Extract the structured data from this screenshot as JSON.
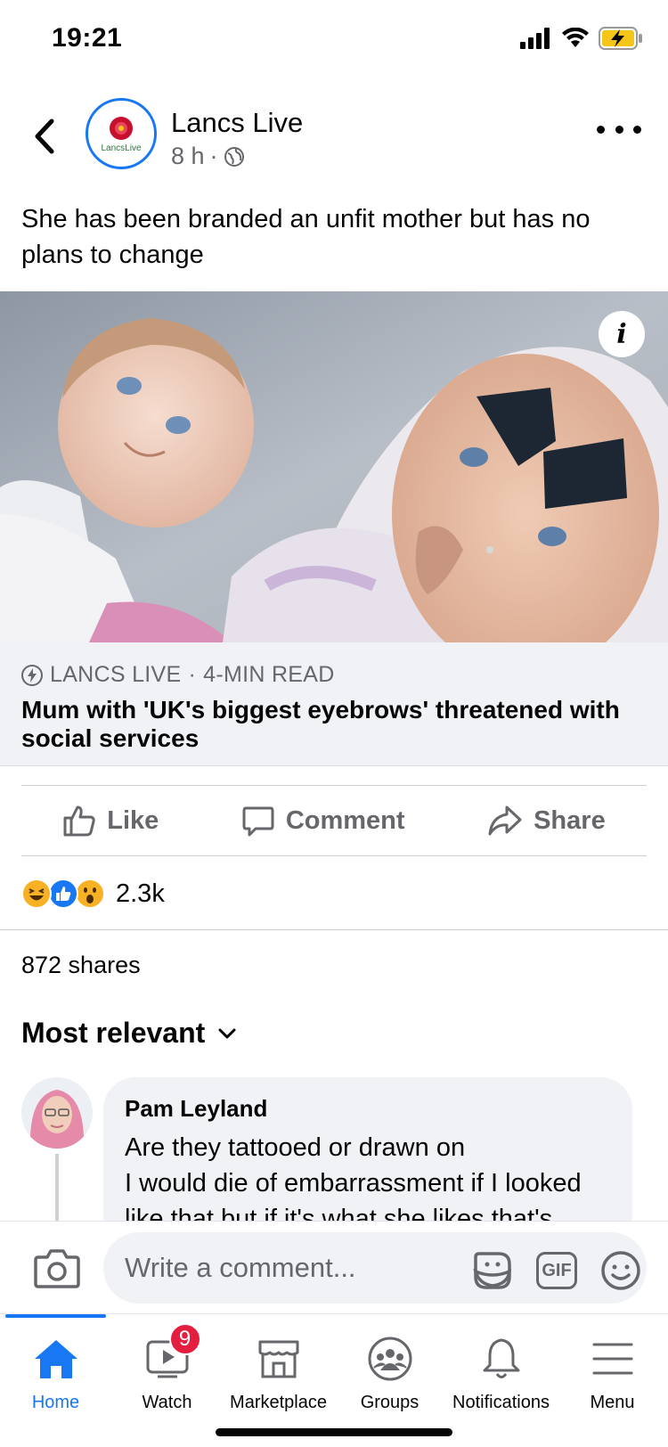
{
  "status_bar": {
    "time": "19:21"
  },
  "post": {
    "page_name": "Lancs Live",
    "avatar_text": "LancsLive",
    "time": "8 h",
    "separator": "·",
    "text": "She has been branded an unfit mother but has no plans to change",
    "link": {
      "source": "LANCS LIVE",
      "read_time": "4-MIN READ",
      "source_separator": "·",
      "title": "Mum with 'UK's biggest eyebrows' threatened with social services"
    },
    "actions": {
      "like": "Like",
      "comment": "Comment",
      "share": "Share"
    },
    "reaction_count": "2.3k",
    "shares": "872 shares"
  },
  "comments": {
    "sort_label": "Most relevant",
    "items": [
      {
        "author": "Pam Leyland",
        "text": "Are they tattooed or drawn on\nI would die of embarrassment if I looked like that but if it's what she likes that's"
      }
    ]
  },
  "composer": {
    "placeholder": "Write a comment...",
    "gif_label": "GIF"
  },
  "nav": {
    "items": [
      {
        "label": "Home",
        "active": true
      },
      {
        "label": "Watch",
        "badge": "9"
      },
      {
        "label": "Marketplace"
      },
      {
        "label": "Groups"
      },
      {
        "label": "Notifications"
      },
      {
        "label": "Menu"
      }
    ]
  },
  "icons": {
    "back": "chevron-left-icon",
    "more": "more-dots-icon",
    "globe": "globe-icon",
    "info": "info-icon",
    "bolt": "lightning-icon",
    "like": "thumbs-up-icon",
    "comment": "speech-bubble-icon",
    "share": "share-arrow-icon",
    "camera": "camera-icon",
    "sticker": "sticker-icon",
    "emoji": "smiley-icon"
  },
  "colors": {
    "accent": "#1877f2",
    "secondary_text": "#65676b",
    "badge": "#e41e3f",
    "link_bg": "#f0f2f5"
  }
}
